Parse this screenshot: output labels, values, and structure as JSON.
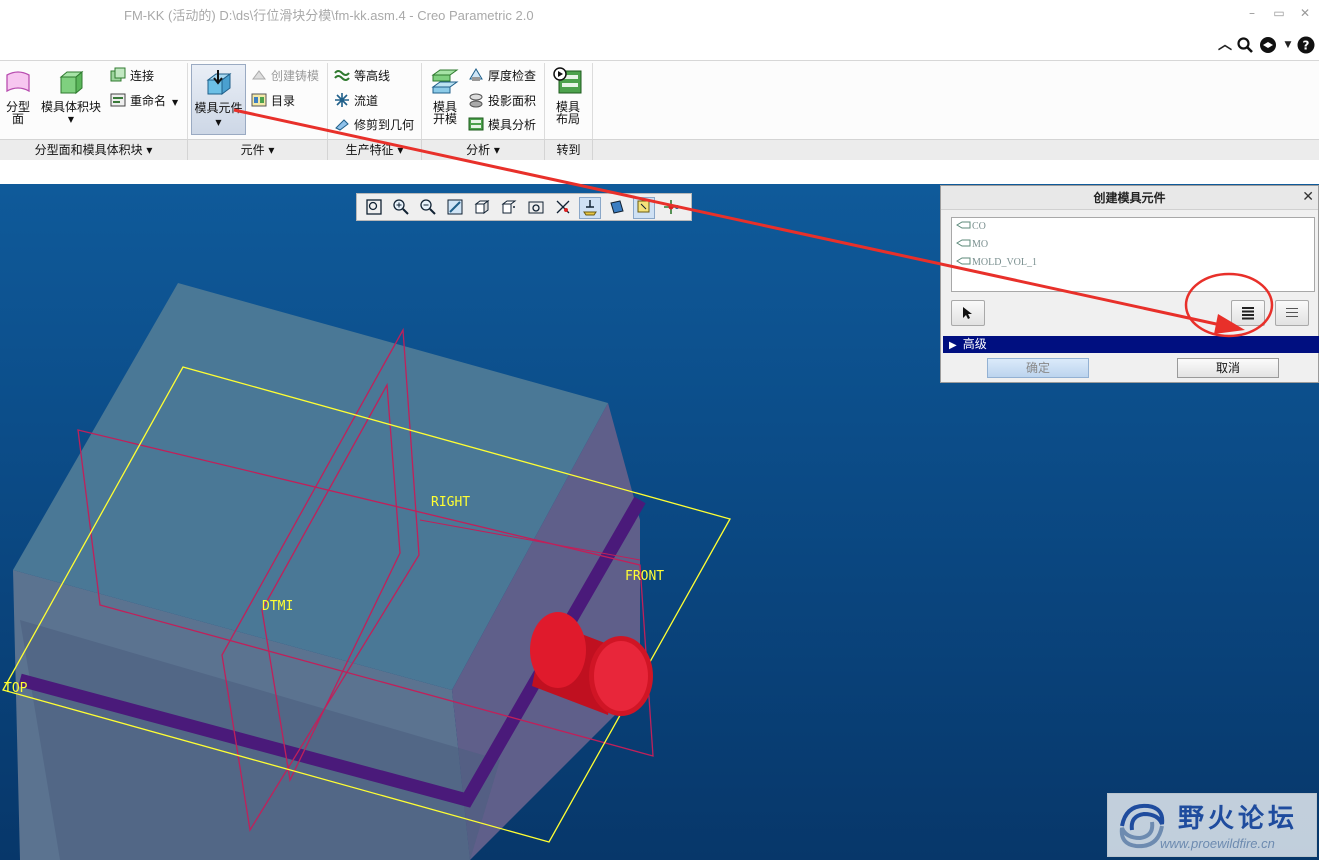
{
  "window": {
    "title": "FM-KK (活动的) D:\\ds\\行位滑块分模\\fm-kk.asm.4 - Creo Parametric 2.0",
    "controls": [
      "minimize",
      "maximize",
      "close"
    ]
  },
  "quick_icons": [
    "collapse-ribbon-icon",
    "search-icon",
    "help-center-icon",
    "dropdown-icon",
    "help-icon"
  ],
  "ribbon": {
    "groups": [
      {
        "label": "分型面和模具体积块 ▾"
      },
      {
        "label": "元件 ▾"
      },
      {
        "label": "生产特征 ▾"
      },
      {
        "label": "分析 ▾"
      },
      {
        "label": "转到"
      }
    ],
    "buttons": {
      "parting_surface": "分型\n面",
      "mold_volume": "模具体积块",
      "connect": "连接",
      "rename": "重命名",
      "mold_component": "模具元件",
      "create_casting": "创建铸模",
      "catalog": "目录",
      "contour": "等高线",
      "runner": "流道",
      "trim_geometry": "修剪到几何",
      "mold_open": "模具\n开模",
      "thickness_check": "厚度检查",
      "projected_area": "投影面积",
      "mold_analysis": "模具分析",
      "mold_layout": "模具\n布局"
    }
  },
  "view_toolbar": {
    "tools": [
      "refit-icon",
      "zoom-in-icon",
      "zoom-out-icon",
      "repaint-icon",
      "display-style-icon",
      "saved-views-icon",
      "view-manager-icon",
      "perspective-icon",
      "datum-display-icon",
      "annotation-display-icon",
      "plane-display-icon",
      "spin-center-icon"
    ]
  },
  "viewport": {
    "plane_labels": {
      "right": "RIGHT",
      "front": "FRONT",
      "dtm1": "DTMI",
      "top": "TOP"
    }
  },
  "dialog": {
    "title": "创建模具元件",
    "items": [
      "CO",
      "MO",
      "MOLD_VOL_1"
    ],
    "advanced_label": "高级",
    "ok_label": "确定",
    "cancel_label": "取消"
  },
  "watermark": {
    "name": "野火论坛",
    "url": "www.proewildfire.cn"
  },
  "colors": {
    "viewport_top": "#0f5a9a",
    "viewport_bottom": "#07376a",
    "datum_plane": "#ffff33",
    "annotation_red": "#e8302a",
    "advanced_bar": "#000f80"
  }
}
